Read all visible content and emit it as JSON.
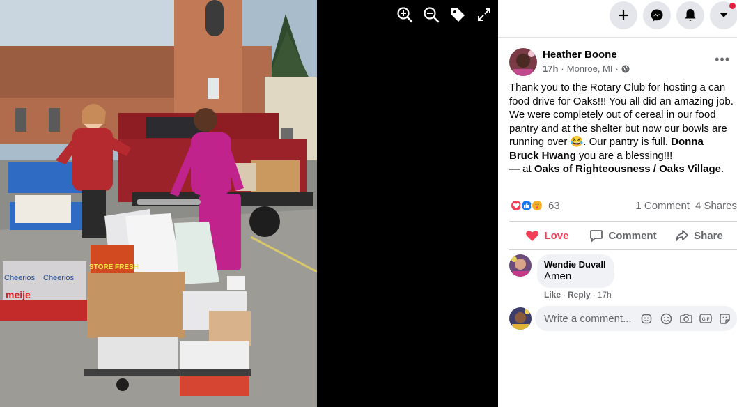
{
  "viewer": {
    "tools": [
      {
        "icon": "zoom-in-icon"
      },
      {
        "icon": "zoom-out-icon"
      },
      {
        "icon": "tag-icon"
      },
      {
        "icon": "fullscreen-icon"
      }
    ],
    "photo": {
      "box_text_1": "Cheerios",
      "box_text_2": "meije",
      "box_text_3": "Cheerios",
      "box_text_4": "STORE FRESH"
    }
  },
  "topbar": {
    "buttons": [
      "create-icon",
      "messenger-icon",
      "notifications-icon",
      "account-menu-icon"
    ]
  },
  "post": {
    "author": "Heather Boone",
    "time": "17h",
    "location_meta": "Monroe, MI",
    "separator": "·",
    "more": "•••",
    "text": {
      "part1": "Thank you to the Rotary Club for hosting a can food drive for Oaks!!! You all did an amazing job. We were completely out of cereal in our food pantry and at the shelter but now our bowls are running over ",
      "emoji": "😂",
      "part2": ". Our pantry is full. ",
      "mention": "Donna Bruck Hwang",
      "part3": " you are a blessing!!!"
    },
    "checkin": {
      "prefix": "— at ",
      "place": "Oaks of Righteousness / Oaks Village",
      "suffix": "."
    },
    "reactions": {
      "types": [
        "love",
        "like",
        "care"
      ],
      "count": "63"
    },
    "comments_count": "1 Comment",
    "shares_count": "4 Shares",
    "actions": {
      "love": "Love",
      "comment": "Comment",
      "share": "Share"
    },
    "comment": {
      "author": "Wendie Duvall",
      "text": "Amen",
      "like": "Like",
      "dot": "·",
      "reply": "Reply",
      "time": "17h"
    },
    "write_comment": {
      "placeholder": "Write a comment...",
      "icons": [
        "avatar-sticker-icon",
        "emoji-icon",
        "camera-icon",
        "gif-icon",
        "sticker-icon"
      ],
      "gif_label": "GIF"
    }
  },
  "colors": {
    "love": "#f33e58",
    "like": "#1877f2",
    "care": "#f7b125",
    "notification": "#e41e3f",
    "secondary_text": "#65676b"
  }
}
